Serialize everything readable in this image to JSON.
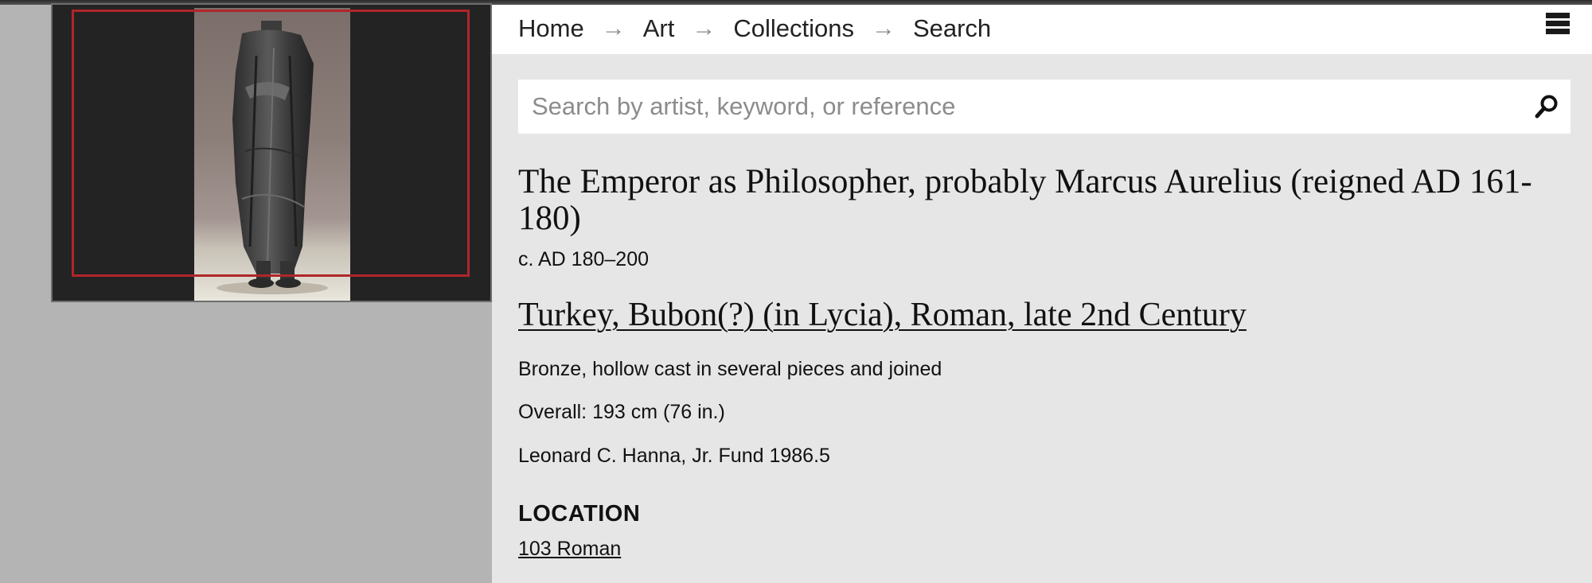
{
  "nav": {
    "breadcrumb": [
      "Home",
      "Art",
      "Collections",
      "Search"
    ],
    "separator": "→"
  },
  "search": {
    "placeholder": "Search by artist, keyword, or reference",
    "value": ""
  },
  "artwork": {
    "title": "The Emperor as Philosopher, probably Marcus Aurelius (reigned AD 161-180)",
    "date": "c. AD 180–200",
    "culture": "Turkey, Bubon(?) (in Lycia), Roman, late 2nd Century",
    "medium": "Bronze, hollow cast in several pieces and joined",
    "dimensions": "Overall: 193 cm (76 in.)",
    "credit": "Leonard C. Hanna, Jr. Fund 1986.5",
    "location_heading": "LOCATION",
    "location": "103 Roman"
  },
  "icons": {
    "menu": "hamburger-menu-icon",
    "search": "magnifier-icon"
  },
  "colors": {
    "focus_frame": "#b0262b",
    "panel_bg": "#e6e6e6",
    "page_bg": "#b4b4b4"
  }
}
